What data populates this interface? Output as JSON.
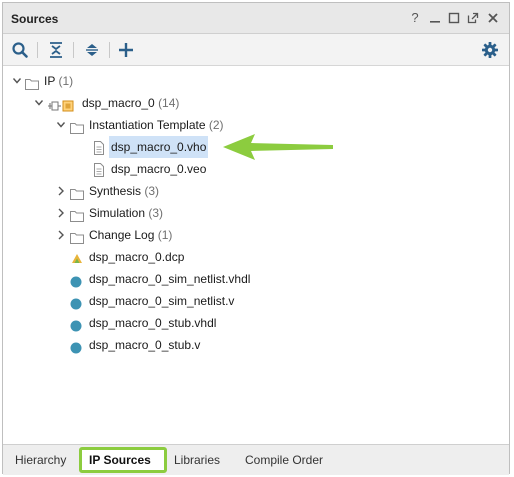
{
  "panel": {
    "title": "Sources",
    "help_glyph": "?",
    "accent_color": "#8ccc3f"
  },
  "toolbar": {
    "icons": [
      "search-icon",
      "collapse-all-icon",
      "expand-all-icon",
      "add-icon",
      "settings-icon"
    ]
  },
  "tree": {
    "ip": {
      "label": "IP",
      "count": "(1)"
    },
    "core": {
      "label": "dsp_macro_0",
      "count": "(14)"
    },
    "inst_template": {
      "label": "Instantiation Template",
      "count": "(2)"
    },
    "vho": {
      "label": "dsp_macro_0.vho"
    },
    "veo": {
      "label": "dsp_macro_0.veo"
    },
    "synthesis": {
      "label": "Synthesis",
      "count": "(3)"
    },
    "simulation": {
      "label": "Simulation",
      "count": "(3)"
    },
    "changelog": {
      "label": "Change Log",
      "count": "(1)"
    },
    "dcp": {
      "label": "dsp_macro_0.dcp"
    },
    "sim_vhdl": {
      "label": "dsp_macro_0_sim_netlist.vhdl"
    },
    "sim_v": {
      "label": "dsp_macro_0_sim_netlist.v"
    },
    "stub_vhdl": {
      "label": "dsp_macro_0_stub.vhdl"
    },
    "stub_v": {
      "label": "dsp_macro_0_stub.v"
    }
  },
  "tabs": {
    "hierarchy": "Hierarchy",
    "ip_sources": "IP Sources",
    "libraries": "Libraries",
    "compile_order": "Compile Order",
    "active": "IP Sources"
  }
}
